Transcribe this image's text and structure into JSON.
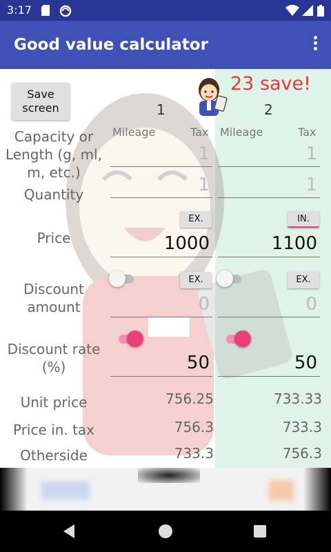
{
  "status": {
    "time": "3:17"
  },
  "appbar": {
    "title": "Good value calculator"
  },
  "save_button": "Save\nscreen",
  "save_result": "23 save!",
  "columns": [
    {
      "number": "1",
      "mileage": "Mileage",
      "tax": "Tax",
      "capacity": "1",
      "quantity": "1",
      "price_mode": "EX.",
      "price": "1000",
      "discount_mode": "EX.",
      "discount_amount": "0",
      "discount_rate": "50",
      "unit_price": "756.25",
      "price_in_tax": "756.3",
      "otherside": "733.3"
    },
    {
      "number": "2",
      "mileage": "Mileage",
      "tax": "Tax",
      "capacity": "1",
      "quantity": "1",
      "price_mode": "IN.",
      "price": "1100",
      "discount_mode": "EX.",
      "discount_amount": "0",
      "discount_rate": "50",
      "unit_price": "733.33",
      "price_in_tax": "733.3",
      "otherside": "756.3"
    }
  ],
  "labels": {
    "capacity": "Capacity or\nLength (g, ml,\nm, etc.)",
    "quantity": "Quantity",
    "price": "Price",
    "discount_amount": "Discount\namount",
    "discount_rate": "Discount rate\n(%)",
    "unit_price": "Unit price",
    "price_in_tax": "Price in. tax",
    "otherside": "Otherside"
  },
  "icons": {
    "status": [
      "sd-card-icon",
      "notification-icon",
      "wifi-icon",
      "signal-icon",
      "battery-icon"
    ],
    "menu": "more-vert-icon",
    "mascot": "clerk-mascot-icon"
  },
  "colors": {
    "appbar": "#3F51B5",
    "statusbar": "#283593",
    "accent": "#EC407A",
    "winner_bg": "#DFF3EA",
    "save_text": "#E53935"
  }
}
